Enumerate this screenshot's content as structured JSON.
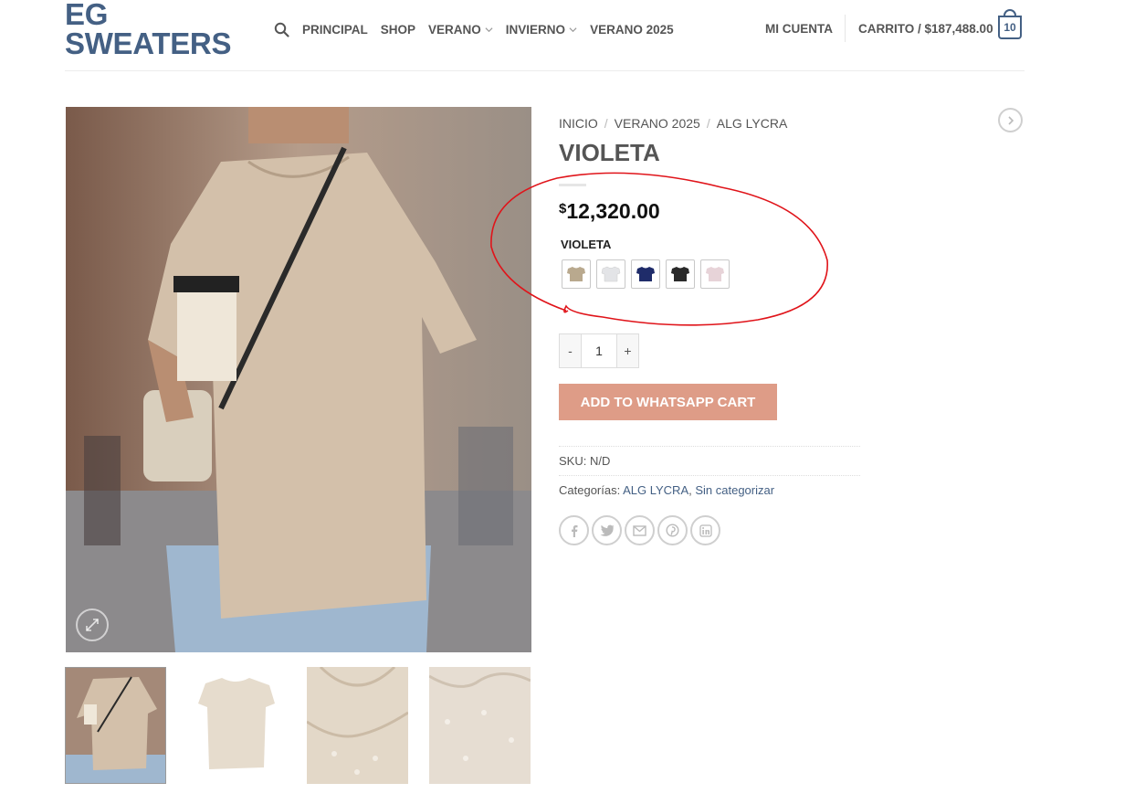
{
  "site": {
    "logo": "EG\nSWEATERS"
  },
  "nav": {
    "items": [
      "PRINCIPAL",
      "SHOP",
      "VERANO",
      "INVIERNO",
      "VERANO 2025"
    ]
  },
  "account": {
    "label": "MI CUENTA"
  },
  "cart": {
    "label": "CARRITO / $187,488.00",
    "count": "10"
  },
  "breadcrumb": [
    "INICIO",
    "VERANO 2025",
    "ALG LYCRA"
  ],
  "product": {
    "title": "VIOLETA",
    "price_currency": "$",
    "price_amount": "12,320.00",
    "variation_label": "VIOLETA",
    "swatches": [
      {
        "name": "beige",
        "color": "#b9a98e"
      },
      {
        "name": "white",
        "color": "#e3e4e7"
      },
      {
        "name": "navy",
        "color": "#1f2c6a"
      },
      {
        "name": "black",
        "color": "#2a2a2a"
      },
      {
        "name": "pink",
        "color": "#e7d3d8"
      }
    ],
    "quantity": "1",
    "qty_minus": "-",
    "qty_plus": "+",
    "add_button": "ADD TO WHATSAPP CART",
    "sku_label": "SKU:",
    "sku_value": "N/D",
    "categories_label": "Categorías:",
    "categories": [
      "ALG LYCRA",
      "Sin categorizar"
    ],
    "categories_sep": ", "
  },
  "share_icons": [
    "facebook-icon",
    "twitter-icon",
    "email-icon",
    "pinterest-icon",
    "linkedin-icon"
  ],
  "colors": {
    "brand": "#446084",
    "button": "#de9c87",
    "annotation": "#e0141a"
  }
}
